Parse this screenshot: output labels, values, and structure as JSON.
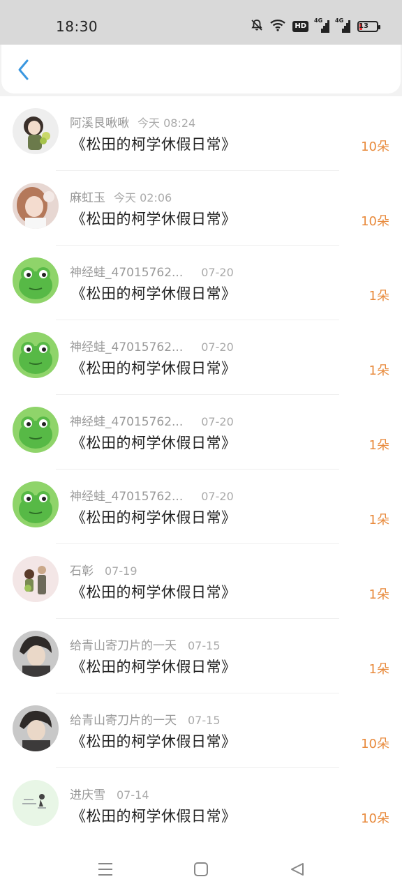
{
  "status_bar": {
    "time": "18:30",
    "hd_label": "HD",
    "network_label_1": "4G",
    "network_label_2": "4G",
    "battery": "13",
    "icons": [
      "mute-bell-icon",
      "wifi-icon",
      "hd-icon",
      "signal-4g-icon",
      "signal-4g-icon",
      "battery-icon"
    ]
  },
  "header": {
    "back_icon": "chevron-left-icon"
  },
  "colors": {
    "accent": "#3a97e0",
    "amount": "#e88a3c",
    "meta": "#999999"
  },
  "items": [
    {
      "user": "阿溪艮啾啾",
      "time": "今天 08:24",
      "title": "《松田的柯学休假日常》",
      "amount": "10朵",
      "avatar": "girl-with-fruit"
    },
    {
      "user": "麻虹玉",
      "time": "今天 02:06",
      "title": "《松田的柯学休假日常》",
      "amount": "10朵",
      "avatar": "photo-girl"
    },
    {
      "user": "神经蛙_47015762...",
      "time": "07-20",
      "title": "《松田的柯学休假日常》",
      "amount": "1朵",
      "avatar": "frog"
    },
    {
      "user": "神经蛙_47015762...",
      "time": "07-20",
      "title": "《松田的柯学休假日常》",
      "amount": "1朵",
      "avatar": "frog"
    },
    {
      "user": "神经蛙_47015762...",
      "time": "07-20",
      "title": "《松田的柯学休假日常》",
      "amount": "1朵",
      "avatar": "frog"
    },
    {
      "user": "神经蛙_47015762...",
      "time": "07-20",
      "title": "《松田的柯学休假日常》",
      "amount": "1朵",
      "avatar": "frog"
    },
    {
      "user": "石彰",
      "time": "07-19",
      "title": "《松田的柯学休假日常》",
      "amount": "1朵",
      "avatar": "illustration-two-people"
    },
    {
      "user": "给青山寄刀片的一天",
      "time": "07-15",
      "title": "《松田的柯学休假日常》",
      "amount": "1朵",
      "avatar": "anime-boy"
    },
    {
      "user": "给青山寄刀片的一天",
      "time": "07-15",
      "title": "《松田的柯学休假日常》",
      "amount": "10朵",
      "avatar": "anime-boy"
    },
    {
      "user": "进庆雪",
      "time": "07-14",
      "title": "《松田的柯学休假日常》",
      "amount": "10朵",
      "avatar": "sketch-note"
    }
  ],
  "nav": {
    "menu_icon": "menu-icon",
    "home_icon": "square-home-icon",
    "back_icon": "triangle-back-icon"
  }
}
